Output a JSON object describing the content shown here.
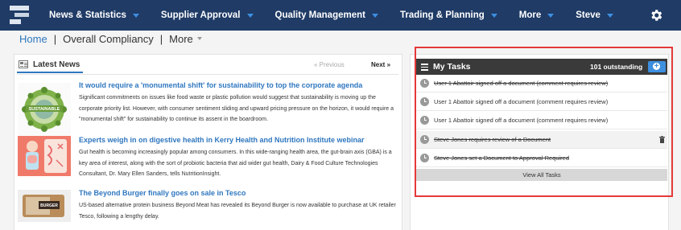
{
  "nav": {
    "items": [
      {
        "label": "News & Statistics"
      },
      {
        "label": "Supplier Approval"
      },
      {
        "label": "Quality Management"
      },
      {
        "label": "Trading & Planning"
      },
      {
        "label": "More"
      },
      {
        "label": "Steve"
      }
    ],
    "accent_color": "#3d8fe0",
    "background_color": "#1f3b66"
  },
  "breadcrumb": {
    "home": "Home",
    "separator": "|",
    "current": "Overall Compliancy",
    "more": "More"
  },
  "news": {
    "title": "Latest News",
    "prev_label": "« Previous",
    "next_label": "Next »",
    "articles": [
      {
        "title": "It would require a 'monumental shift' for sustainability to top the corporate agenda",
        "body": "Significant commitments on issues like food waste or plastic pollution would suggest that sustainability is moving up the corporate priority list. However, with consumer sentiment sliding and upward pricing pressure on the horizon, it would require a \"monumental shift\" for sustainability to continue its assent in the boardroom.",
        "image_label": "SUSTAINABLE"
      },
      {
        "title": "Experts weigh in on digestive health in Kerry Health and Nutrition Institute webinar",
        "body": "Gut health is becoming increasingly popular among consumers. In this wide-ranging health area, the gut-brain axis (GBA) is a key area of interest, along with the sort of probiotic bacteria that aid wider gut health, Dairy & Food Culture Technologies Consultant, Dr. Mary Ellen Sanders, tells NutritionInsight."
      },
      {
        "title": "The Beyond Burger finally goes on sale in Tesco",
        "body": "US-based alternative protein business Beyond Meat has revealed its Beyond Burger is now available to purchase at UK retailer Tesco, following a lengthy delay.",
        "image_label": "BURGER"
      }
    ]
  },
  "tasks": {
    "title": "My Tasks",
    "count": "101 outstanding",
    "items": [
      {
        "text": "User 1 Abattoir signed off a document (comment requires review)",
        "done": true
      },
      {
        "text": "User 1 Abattoir signed off a document (comment requires review)",
        "done": false
      },
      {
        "text": "User 1 Abattoir signed off a document (comment requires review)",
        "done": false
      },
      {
        "text": "Steve Jones requires review of a Document",
        "done": true
      },
      {
        "text": "Steve Jones set a Document to Approval Required",
        "done": true
      }
    ],
    "view_all": "View All Tasks",
    "highlight_color": "#e53939"
  }
}
